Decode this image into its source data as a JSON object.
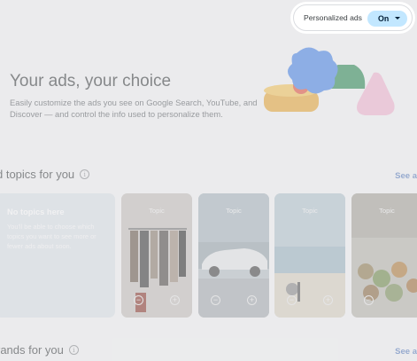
{
  "hero": {
    "title": "Your ads, your choice",
    "description": "Easily customize the ads you see on Google Search, YouTube, and Discover — and control the info used to personalize them."
  },
  "personalized_ads": {
    "label": "Personalized ads",
    "value": "On"
  },
  "topics_section": {
    "title": "d topics for you",
    "see_all": "See a"
  },
  "no_topics": {
    "heading": "No topics here",
    "text": "You'll be able to choose which topics you want to see more or fewer ads about soon."
  },
  "topic_cards": [
    {
      "label": "Topic",
      "image": "clothing-rack"
    },
    {
      "label": "Topic",
      "image": "convertible-car"
    },
    {
      "label": "Topic",
      "image": "beach"
    },
    {
      "label": "Topic",
      "image": "produce-market"
    }
  ],
  "brands_section": {
    "title": "rands for you",
    "see_all": "See a"
  },
  "colors": {
    "toggle_on": "#c2e7ff",
    "page_bg": "#f4f5f6"
  }
}
